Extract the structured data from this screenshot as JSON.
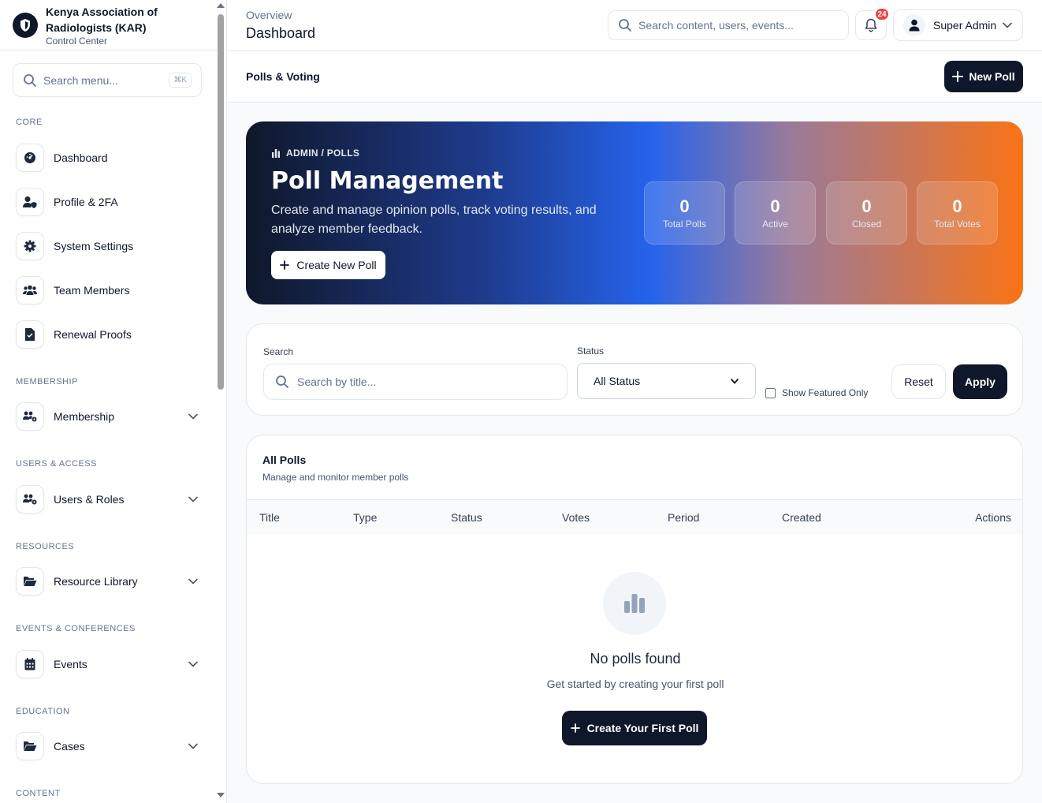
{
  "brand": {
    "name": "Kenya Association of Radiologists (KAR)",
    "subtitle": "Control Center"
  },
  "sidebar_search": {
    "placeholder": "Search menu...",
    "shortcut": "⌘K"
  },
  "sections": {
    "core": "CORE",
    "membership": "MEMBERSHIP",
    "users_access": "USERS & ACCESS",
    "resources": "RESOURCES",
    "events": "EVENTS & CONFERENCES",
    "education": "EDUCATION",
    "content": "CONTENT"
  },
  "nav": {
    "dashboard": "Dashboard",
    "profile": "Profile & 2FA",
    "settings": "System Settings",
    "team": "Team Members",
    "renewal": "Renewal Proofs",
    "membership": "Membership",
    "users_roles": "Users & Roles",
    "resource_library": "Resource Library",
    "events": "Events",
    "cases": "Cases"
  },
  "topbar": {
    "breadcrumb": "Overview",
    "title": "Dashboard",
    "search_placeholder": "Search content, users, events...",
    "notification_count": "24",
    "user_name": "Super Admin"
  },
  "subbar": {
    "title": "Polls & Voting",
    "new_poll": "New Poll"
  },
  "hero": {
    "tag": "ADMIN / POLLS",
    "title": "Poll Management",
    "description": "Create and manage opinion polls, track voting results, and analyze member feedback.",
    "button": "Create New Poll",
    "stats": [
      {
        "value": "0",
        "label": "Total Polls"
      },
      {
        "value": "0",
        "label": "Active"
      },
      {
        "value": "0",
        "label": "Closed"
      },
      {
        "value": "0",
        "label": "Total Votes"
      }
    ]
  },
  "filters": {
    "search_label": "Search",
    "search_placeholder": "Search by title...",
    "status_label": "Status",
    "status_value": "All Status",
    "featured_label": "Show Featured Only",
    "reset": "Reset",
    "apply": "Apply"
  },
  "table": {
    "title": "All Polls",
    "subtitle": "Manage and monitor member polls",
    "columns": [
      "Title",
      "Type",
      "Status",
      "Votes",
      "Period",
      "Created",
      "Actions"
    ],
    "empty_title": "No polls found",
    "empty_subtitle": "Get started by creating your first poll",
    "empty_button": "Create Your First Poll"
  },
  "colors": {
    "primary": "#0f172a",
    "accent_blue": "#2563eb",
    "accent_orange": "#f97316",
    "badge": "#ef4444"
  }
}
